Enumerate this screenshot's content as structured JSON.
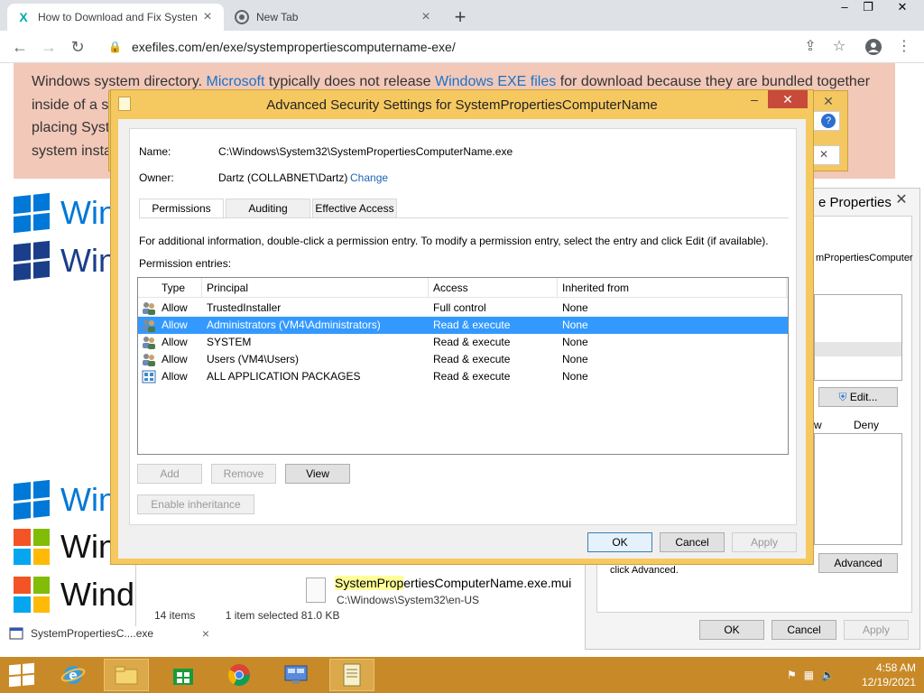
{
  "browser": {
    "tabs": [
      {
        "title": "How to Download and Fix Systen",
        "favicon": "x-site-icon",
        "active": true
      },
      {
        "title": "New Tab",
        "favicon": "chrome-icon",
        "active": false
      }
    ],
    "url": "exefiles.com/en/exe/systempropertiescomputername-exe/"
  },
  "page": {
    "text_parts": [
      {
        "text": "Windows system directory. ",
        "link": false
      },
      {
        "text": "Microsoft",
        "link": true
      },
      {
        "text": " typically does not release ",
        "link": false
      },
      {
        "text": "Windows EXE files",
        "link": true
      },
      {
        "text": " for download because they are bundled together",
        "link": false
      }
    ],
    "line2": "inside of a s",
    "line3": "placing Syst",
    "line4": "system insta",
    "logos": [
      "Win",
      "Win",
      "Win",
      "Win",
      "Windo"
    ],
    "download_item": "SystemPropertiesC....exe"
  },
  "explorer": {
    "file_name_hl": "SystemProp",
    "file_name_rest": "ertiesComputerName.exe.mui",
    "file_path": "C:\\Windows\\System32\\en-US",
    "status_count": "14 items",
    "status_selected": "1 item selected  81.0 KB"
  },
  "props": {
    "title": "e Properties",
    "name_snip": "mPropertiesComputer",
    "edit_label": "Edit...",
    "allow_label": "w",
    "deny_label": "Deny",
    "advanced_hint": "click Advanced.",
    "advanced_label": "Advanced",
    "ok_label": "OK",
    "cancel_label": "Cancel",
    "apply_label": "Apply"
  },
  "dialog": {
    "title": "Advanced Security Settings for SystemPropertiesComputerName",
    "name_label": "Name:",
    "name_value": "C:\\Windows\\System32\\SystemPropertiesComputerName.exe",
    "owner_label": "Owner:",
    "owner_value": "Dartz (COLLABNET\\Dartz)",
    "change_label": "Change",
    "tabs": [
      "Permissions",
      "Auditing",
      "Effective Access"
    ],
    "info_text": "For additional information, double-click a permission entry. To modify a permission entry, select the entry and click Edit (if available).",
    "entries_label": "Permission entries:",
    "columns": [
      "Type",
      "Principal",
      "Access",
      "Inherited from"
    ],
    "rows": [
      {
        "type": "Allow",
        "principal": "TrustedInstaller",
        "access": "Full control",
        "inherited": "None",
        "icon": "users-icon",
        "selected": false
      },
      {
        "type": "Allow",
        "principal": "Administrators (VM4\\Administrators)",
        "access": "Read & execute",
        "inherited": "None",
        "icon": "users-icon",
        "selected": true
      },
      {
        "type": "Allow",
        "principal": "SYSTEM",
        "access": "Read & execute",
        "inherited": "None",
        "icon": "users-icon",
        "selected": false
      },
      {
        "type": "Allow",
        "principal": "Users (VM4\\Users)",
        "access": "Read & execute",
        "inherited": "None",
        "icon": "users-icon",
        "selected": false
      },
      {
        "type": "Allow",
        "principal": "ALL APPLICATION PACKAGES",
        "access": "Read & execute",
        "inherited": "None",
        "icon": "package-icon",
        "selected": false
      }
    ],
    "add_label": "Add",
    "remove_label": "Remove",
    "view_label": "View",
    "enable_inheritance_label": "Enable inheritance",
    "ok_label": "OK",
    "cancel_label": "Cancel",
    "apply_label": "Apply"
  },
  "taskbar": {
    "time": "4:58 AM",
    "date": "12/19/2021"
  },
  "colors": {
    "dialog_frame": "#f6c960",
    "taskbar": "#c88a28",
    "selection": "#3399ff",
    "close_red": "#c74a3a"
  }
}
